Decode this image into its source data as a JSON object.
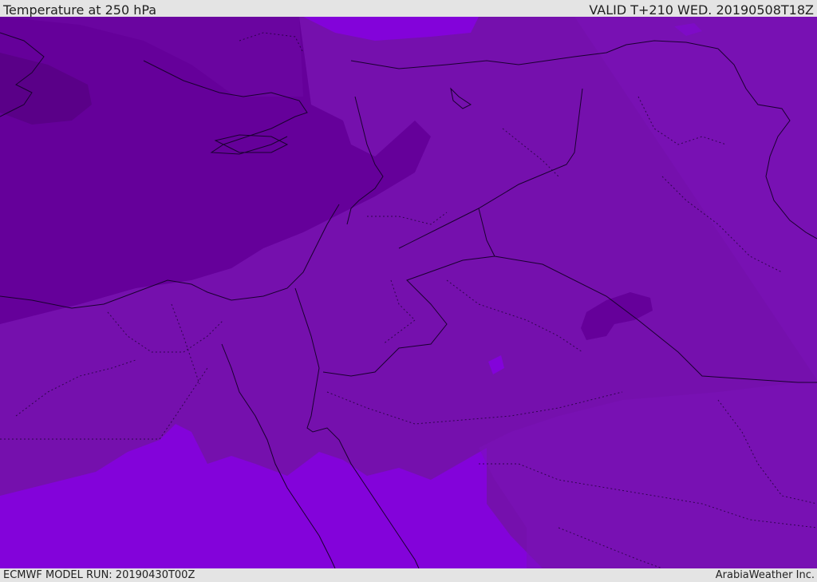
{
  "header": {
    "title": "Temperature at 250 hPa",
    "valid": "VALID T+210 WED. 20190508T18Z"
  },
  "footer": {
    "model_run": "ECMWF MODEL RUN: 20190430T00Z",
    "credit": "ArabiaWeather Inc."
  },
  "map": {
    "colors": {
      "cold": "#65009a",
      "mid": "#7510ad",
      "mid_alt": "#7a12b8",
      "warm": "#8303da",
      "coast": "#1a0030"
    }
  }
}
